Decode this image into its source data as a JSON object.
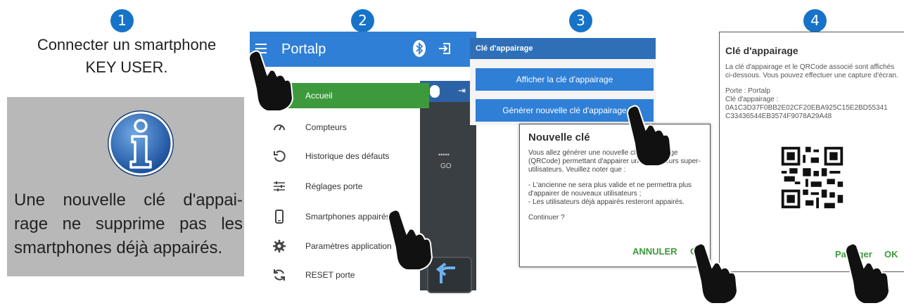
{
  "steps": [
    "1",
    "2",
    "3",
    "4"
  ],
  "intro": {
    "line1": "Connecter un smartphone",
    "line2": "KEY USER."
  },
  "info": {
    "icon": "info-icon",
    "text_line1": "Une nouvelle clé d'appai-",
    "text_line2": "rage ne supprime pas les",
    "text_line3": "smartphones déjà appairés."
  },
  "panel2": {
    "title": "Portalp",
    "menu": [
      {
        "label": "Accueil",
        "icon": "home-icon"
      },
      {
        "label": "Compteurs",
        "icon": "gauge-icon"
      },
      {
        "label": "Historique des défauts",
        "icon": "history-icon"
      },
      {
        "label": "Réglages porte",
        "icon": "sliders-icon"
      },
      {
        "label": "Smartphones appairés",
        "icon": "smartphone-icon"
      },
      {
        "label": "Paramètres application",
        "icon": "gear-icon"
      },
      {
        "label": "RESET porte",
        "icon": "reset-icon"
      }
    ],
    "side_dots": "•••••",
    "side_go": "GO"
  },
  "panel3": {
    "title": "Clé d'appairage",
    "show_button": "Afficher la clé d'appairage",
    "generate_button": "Générer nouvelle clé d'appairage",
    "dialog": {
      "title": "Nouvelle clé",
      "body1": "Vous allez générer une nouvelle clé d'appairage (QRCode) permettant d'appairer un ou plusieurs super-utilisateurs. Veuillez noter que :",
      "body2": "- L'ancienne ne sera plus valide et ne permettra plus d'appairer de nouveaux utilisateurs ;",
      "body3": "- Les utilisateurs déjà appairés resteront appairés.",
      "body4": "Continuer ?",
      "cancel": "ANNULER",
      "ok": "OK"
    }
  },
  "panel4": {
    "title": "Clé d'appairage",
    "body1": "La clé d'appairage et le QRCode associé sont affichés ci-dessous. Vous pouvez effectuer une capture d'écran.",
    "door_label": "Porte : Portalp",
    "key_label": "Clé d'appairage :",
    "key_value1": "0A1C3D37F0BB2E02CF20EBA925C15E2BD55341",
    "key_value2": "C33436544EB3574F9078A29A48",
    "share": "Partager",
    "ok": "OK"
  },
  "colors": {
    "step_blue": "#1673c8",
    "app_bar_blue": "#2f7fd6",
    "active_green": "#3c9a3c",
    "info_gray": "#b8b8b8"
  }
}
